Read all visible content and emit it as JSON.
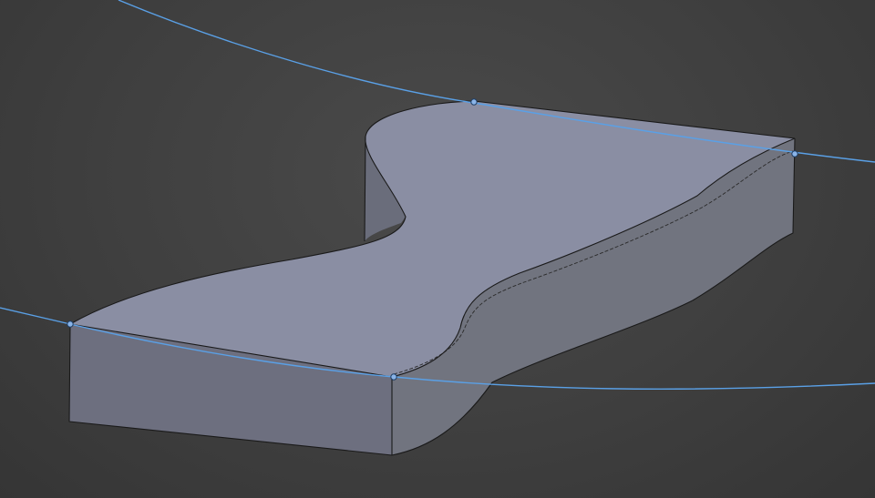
{
  "viewport": {
    "background_color": "#404040"
  },
  "model": {
    "top_face_color": "#8a8ea3",
    "front_face_color": "#6d6f7f",
    "curved_side_color": "#71747f",
    "far_side_color": "#6a6d7b",
    "edge_color": "#1a1a1a"
  },
  "guide_curves": {
    "color": "#5aa0e6",
    "vertex_fill": "#8ab4e8",
    "count": 2,
    "vertices_per_curve": 2
  }
}
